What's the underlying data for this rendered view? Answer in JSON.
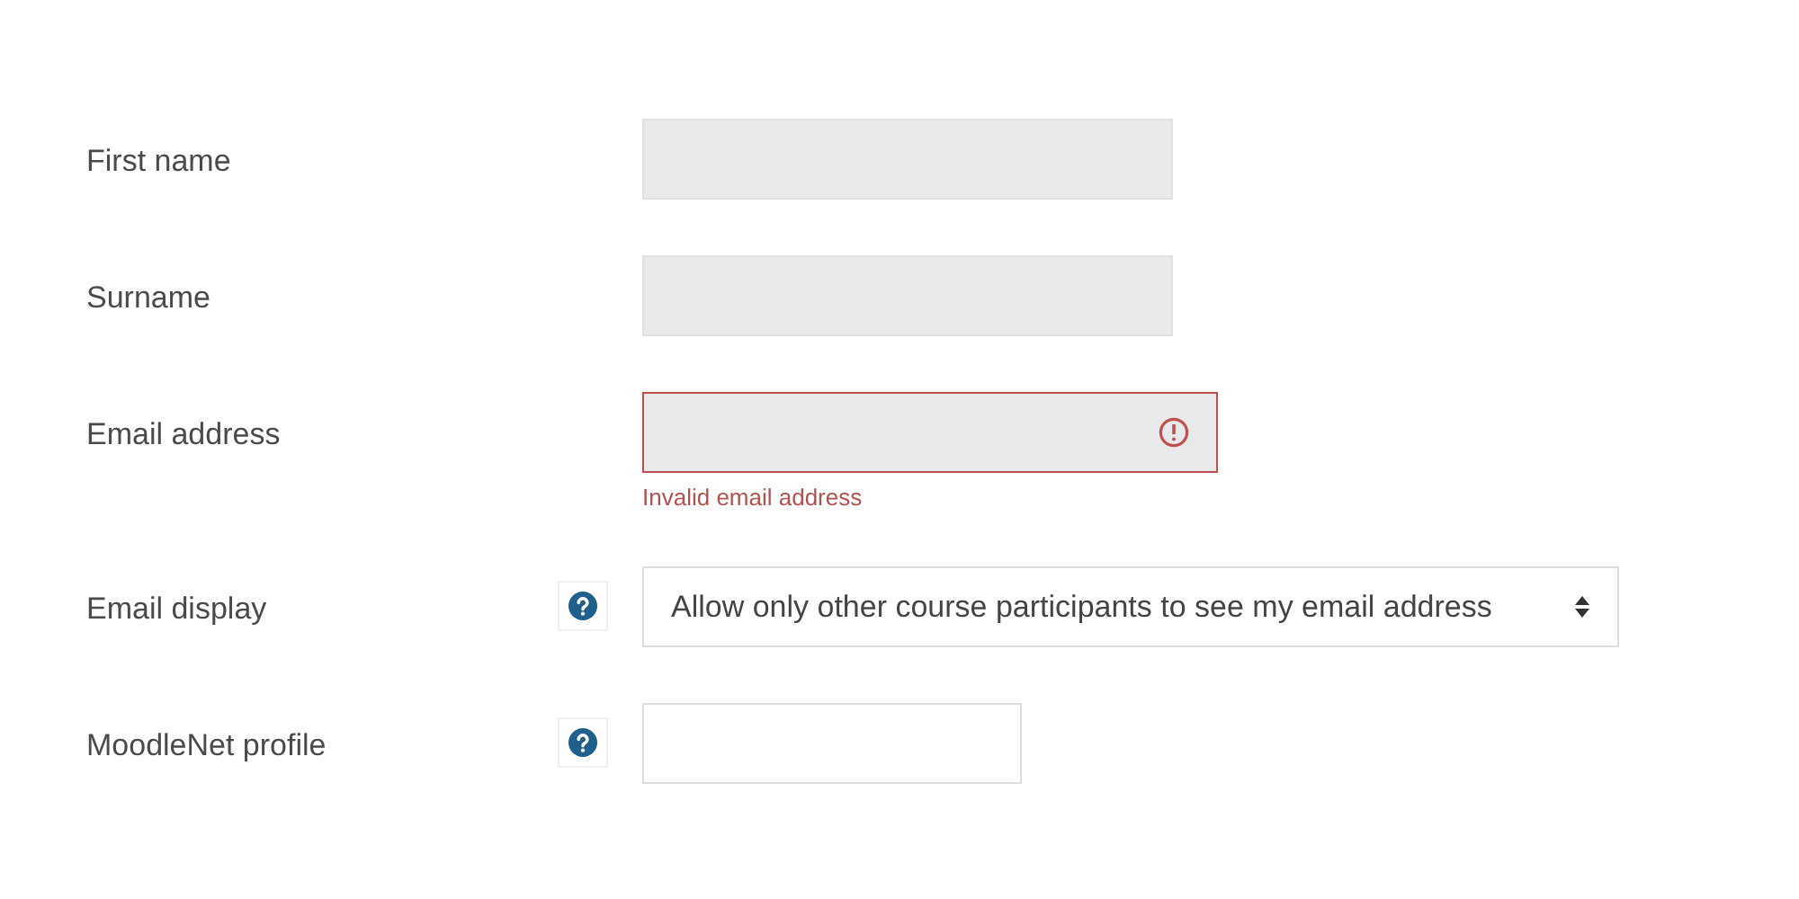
{
  "fields": [
    {
      "label": "First name",
      "kind": "text",
      "help": false,
      "disabled": true,
      "invalid": false
    },
    {
      "label": "Surname",
      "kind": "text",
      "help": false,
      "disabled": true,
      "invalid": false
    },
    {
      "label": "Email address",
      "kind": "text",
      "help": false,
      "disabled": true,
      "invalid": true,
      "error": "Invalid email address"
    },
    {
      "label": "Email display",
      "kind": "select",
      "help": true,
      "disabled": false,
      "invalid": false,
      "value": "Allow only other course participants to see my email address"
    },
    {
      "label": "MoodleNet profile",
      "kind": "text",
      "help": true,
      "disabled": false,
      "invalid": false
    }
  ]
}
